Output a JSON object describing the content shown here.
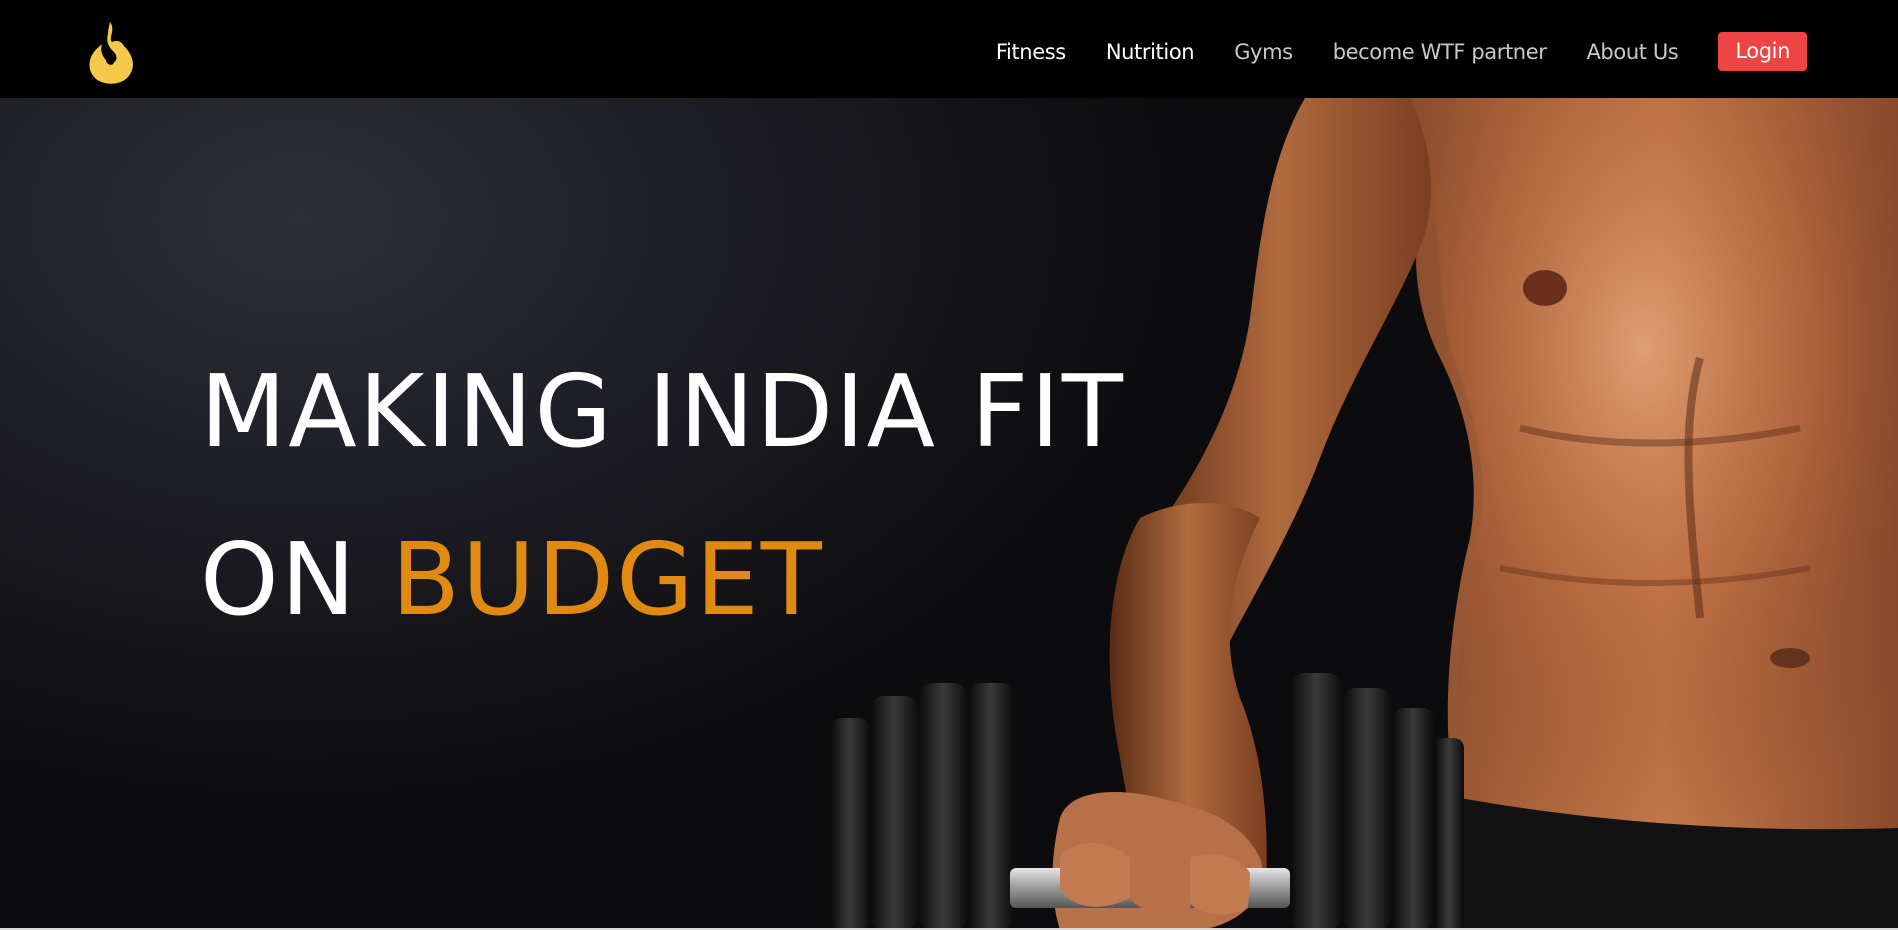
{
  "header": {
    "logo_icon": "flame-icon",
    "brand_color": "#f5c94a",
    "nav": [
      {
        "label": "Fitness",
        "active": true
      },
      {
        "label": "Nutrition",
        "active": true
      },
      {
        "label": "Gyms",
        "active": false
      },
      {
        "label": "become WTF partner",
        "active": false
      },
      {
        "label": "About Us",
        "active": false
      }
    ],
    "login_label": "Login",
    "login_color": "#ef4444"
  },
  "hero": {
    "line1": "MAKING INDIA FIT",
    "line2_prefix": "ON",
    "line2_accent": "BUDGET",
    "accent_color": "#e08a12",
    "image": "muscular-man-holding-dumbbell"
  }
}
